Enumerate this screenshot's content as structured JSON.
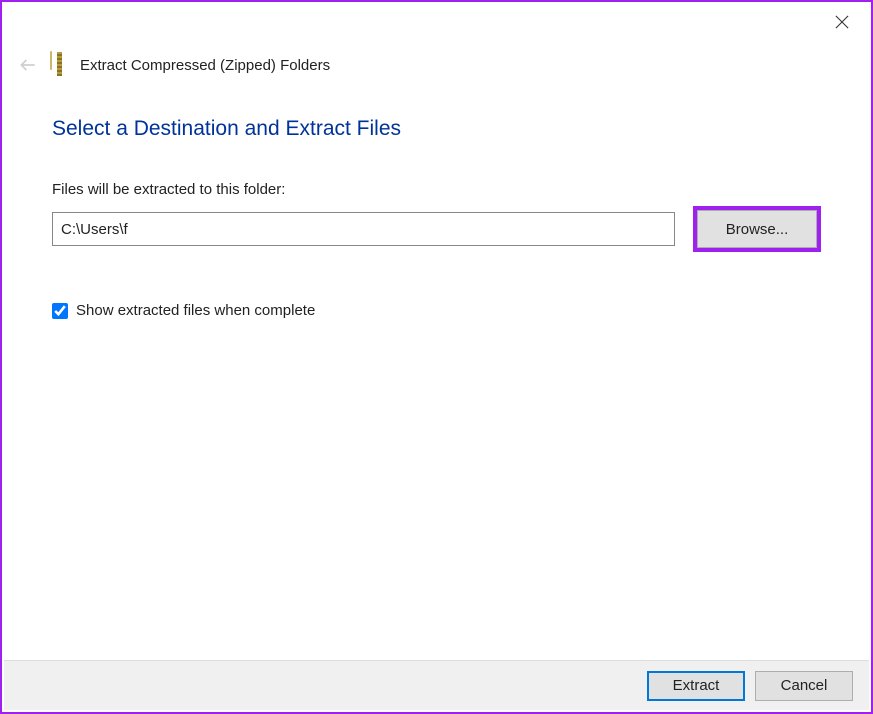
{
  "header": {
    "wizard_title": "Extract Compressed (Zipped) Folders"
  },
  "main": {
    "heading": "Select a Destination and Extract Files",
    "field_label": "Files will be extracted to this folder:",
    "path_value": "C:\\Users\\f",
    "browse_label": "Browse...",
    "checkbox_label": "Show extracted files when complete",
    "checkbox_checked": true
  },
  "footer": {
    "extract_label": "Extract",
    "cancel_label": "Cancel"
  }
}
